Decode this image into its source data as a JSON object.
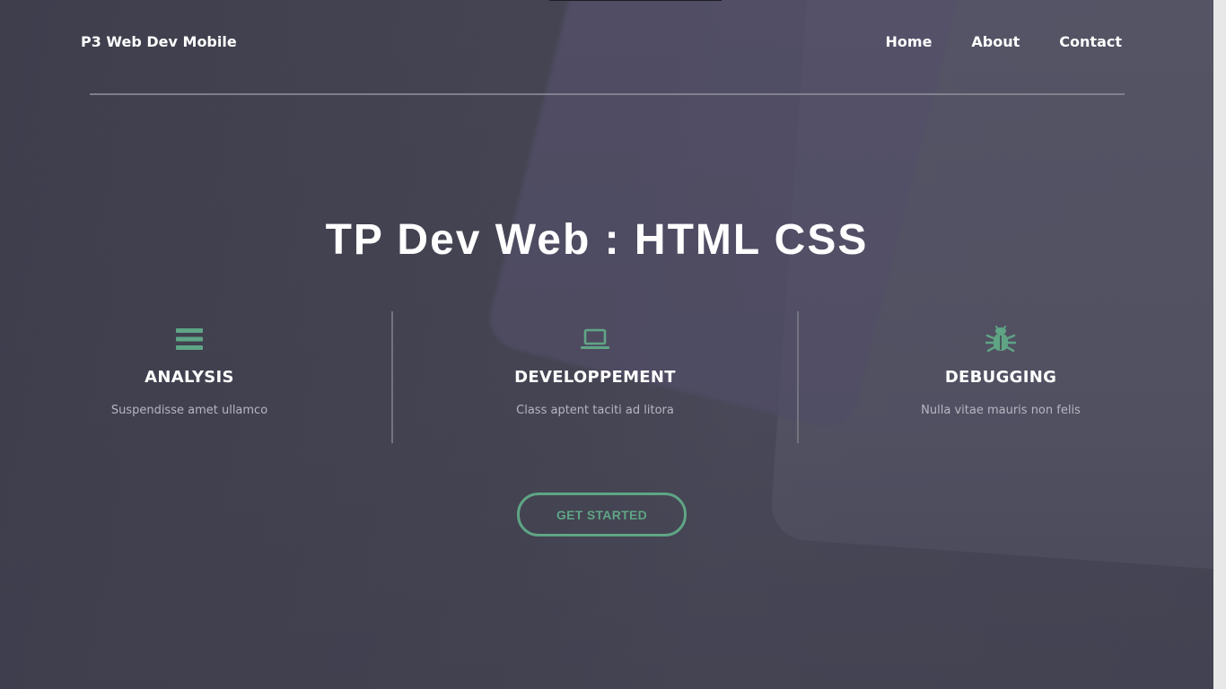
{
  "header": {
    "brand": "P3 Web Dev Mobile",
    "nav": [
      {
        "label": "Home"
      },
      {
        "label": "About"
      },
      {
        "label": "Contact"
      }
    ]
  },
  "hero": {
    "title": "TP Dev Web : HTML CSS"
  },
  "features": [
    {
      "icon": "bars-icon",
      "title": "ANALYSIS",
      "description": "Suspendisse amet ullamco"
    },
    {
      "icon": "laptop-icon",
      "title": "DEVELOPPEMENT",
      "description": "Class aptent taciti ad litora"
    },
    {
      "icon": "bug-icon",
      "title": "DEBUGGING",
      "description": "Nulla vitae mauris non felis"
    }
  ],
  "cta": {
    "label": "GET STARTED"
  },
  "colors": {
    "accent": "#5fa585",
    "background": "#43434f",
    "text": "#ffffff",
    "muted_text": "#b6b6c2"
  }
}
